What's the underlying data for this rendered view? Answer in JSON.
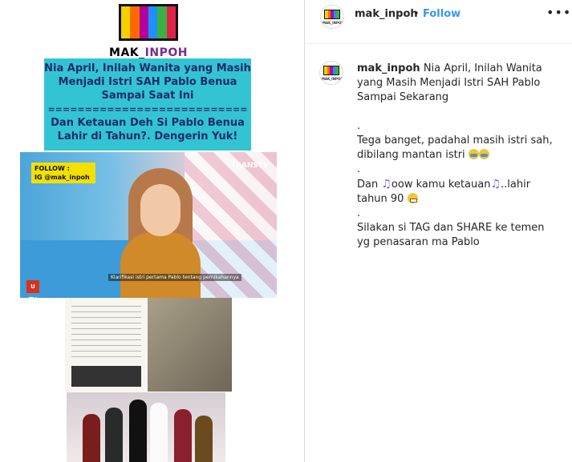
{
  "post_image": {
    "logo_text_main": "MAK_",
    "logo_text_accent": "INPOH",
    "logo_colors": [
      "#f4d000",
      "#ff6a00",
      "#b4009e",
      "#1e90ff",
      "#3cb043",
      "#e0224b"
    ],
    "banner_lines": [
      "Nia April, Inilah Wanita yang Masih",
      "Menjadi Istri SAH Pablo Benua",
      "Sampai Saat Ini"
    ],
    "banner_separator": "===========================",
    "banner_lines_2": [
      "Dan Ketauan Deh Si Pablo Benua",
      "Lahir di Tahun?. Dengerin Yuk!"
    ],
    "follow_badge_line1": "FOLLOW :",
    "follow_badge_line2": "IG @mak_inpoh",
    "channel_logo": "TRANSTV",
    "channel_badge": "U TV",
    "subtitle": "Klarifikasi istri pertama Pablo tentang pernikahannya"
  },
  "header": {
    "username": "mak_inpoh",
    "dot": "•",
    "follow_label": "Follow",
    "more_label": "•••",
    "avatar_text": "MAK_INPOH"
  },
  "caption": {
    "username": "mak_inpoh",
    "text_1": "Nia April, Inilah Wanita yang Masih Menjadi Istri SAH Pablo Sampai Sekarang",
    "dot_1": ".",
    "dot_2": ".",
    "text_2": "Tega banget, padahal masih istri sah, dibilang mantan istri",
    "text_3a": "Dan ",
    "text_3b": "oow kamu ketauan",
    "text_3c": "..lahir tahun 90",
    "music_note": "♫",
    "text_4": "Silakan si TAG dan SHARE ke temen yg penasaran ma Pablo"
  }
}
